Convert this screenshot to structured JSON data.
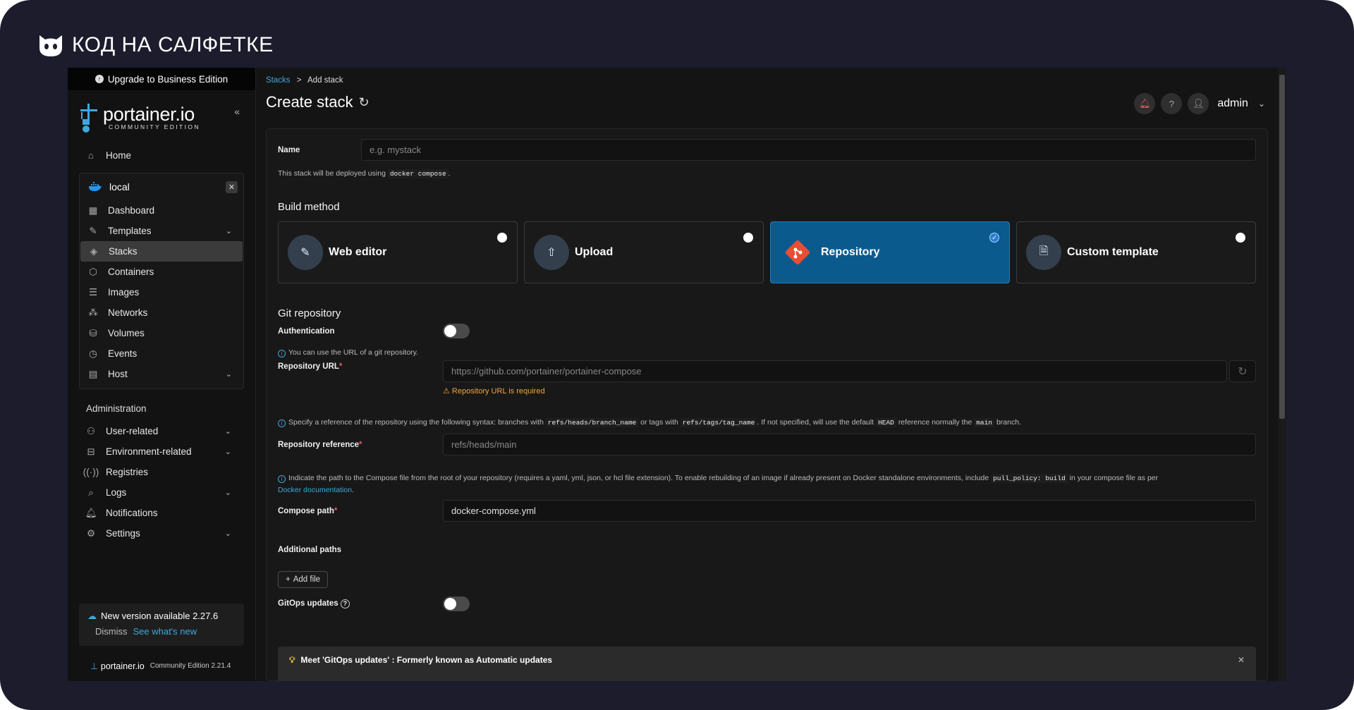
{
  "brand": {
    "text": "КОД НА САЛФЕТКЕ"
  },
  "sidebar": {
    "upgrade": "Upgrade to Business Edition",
    "logo": "portainer.io",
    "logo_sub": "COMMUNITY EDITION",
    "home": "Home",
    "env_name": "local",
    "env_items": [
      "Dashboard",
      "Templates",
      "Stacks",
      "Containers",
      "Images",
      "Networks",
      "Volumes",
      "Events",
      "Host"
    ],
    "admin_title": "Administration",
    "admin_items": [
      "User-related",
      "Environment-related",
      "Registries",
      "Logs",
      "Notifications",
      "Settings"
    ],
    "update_title": "New version available 2.27.6",
    "dismiss": "Dismiss",
    "see_new": "See what's new",
    "footer_logo": "portainer.io",
    "footer_edition": "Community Edition 2.21.4"
  },
  "header": {
    "crumb_link": "Stacks",
    "crumb_sep": ">",
    "crumb_current": "Add stack",
    "title": "Create stack",
    "user": "admin"
  },
  "form": {
    "name_label": "Name",
    "name_placeholder": "e.g. mystack",
    "deploy_help_pre": "This stack will be deployed using",
    "deploy_help_code": "docker compose",
    "deploy_help_post": ".",
    "build_method": "Build method",
    "methods": [
      "Web editor",
      "Upload",
      "Repository",
      "Custom template"
    ],
    "selected_method": "Repository",
    "git_title": "Git repository",
    "auth_label": "Authentication",
    "url_help": "You can use the URL of a git repository.",
    "url_label": "Repository URL",
    "url_placeholder": "https://github.com/portainer/portainer-compose",
    "url_error": "Repository URL is required",
    "ref_help_1": "Specify a reference of the repository using the following syntax: branches with",
    "ref_help_code1": "refs/heads/branch_name",
    "ref_help_2": "or tags with",
    "ref_help_code2": "refs/tags/tag_name",
    "ref_help_3": ". If not specified, will use the default",
    "ref_help_code3": "HEAD",
    "ref_help_4": "reference normally the",
    "ref_help_code4": "main",
    "ref_help_5": "branch.",
    "ref_label": "Repository reference",
    "ref_placeholder": "refs/heads/main",
    "path_help_1": "Indicate the path to the Compose file from the root of your repository (requires a yaml, yml, json, or hcl file extension).  To enable rebuilding of an image if already present on Docker standalone environments, include",
    "path_help_code": "pull_policy: build",
    "path_help_2": "in your compose file as per",
    "path_help_link": "Docker documentation",
    "path_help_3": ".",
    "path_label": "Compose path",
    "path_value": "docker-compose.yml",
    "additional_paths": "Additional paths",
    "add_file": "Add file",
    "gitops_label": "GitOps updates",
    "banner_title": "Meet 'GitOps updates' : Formerly known as Automatic updates"
  }
}
